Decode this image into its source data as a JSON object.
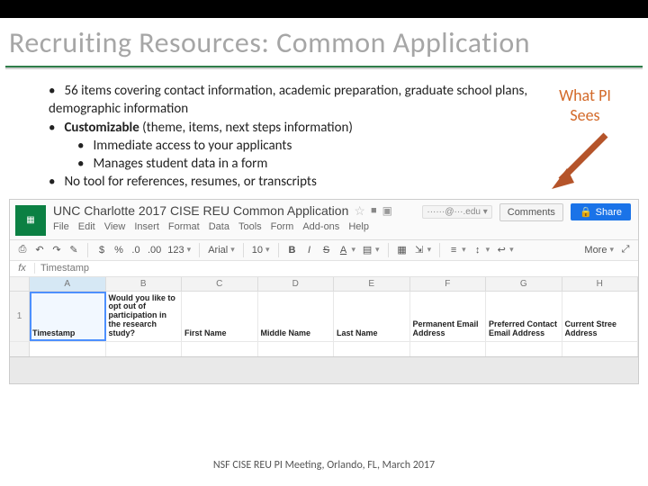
{
  "slide": {
    "title": "Recruiting Resources: Common Application",
    "bullets": {
      "b1": "56 items covering contact information, academic preparation, graduate school plans, demographic information",
      "b2_bold": "Customizable",
      "b2_rest": " (theme, items, next steps information)",
      "b2a": "Immediate access to your applicants",
      "b2b": "Manages student data in a form",
      "b3": "No tool for references, resumes, or transcripts"
    },
    "sideLabel1": "What PI",
    "sideLabel2": "Sees",
    "footer": "NSF CISE REU PI Meeting, Orlando, FL, March 2017"
  },
  "sheets": {
    "docTitle": "UNC Charlotte 2017 CISE REU Common Application",
    "location": "■",
    "menus": [
      "File",
      "Edit",
      "View",
      "Insert",
      "Format",
      "Data",
      "Tools",
      "Form",
      "Add-ons",
      "Help"
    ],
    "emailChip": "······@···.edu ▾",
    "comments": "Comments",
    "share": "Share",
    "toolbar": {
      "currency": "$",
      "percent": "%",
      "dec1": ".0",
      "dec2": ".00",
      "num": "123",
      "font": "Arial",
      "size": "10",
      "bold": "B",
      "italic": "I",
      "strike": "S",
      "underline": "A",
      "more": "More"
    },
    "fx": {
      "label": "fx",
      "value": "Timestamp"
    },
    "cols": [
      "A",
      "B",
      "C",
      "D",
      "E",
      "F",
      "G",
      "H"
    ],
    "headers": {
      "A": "Timestamp",
      "B": "Would you like to opt out of participation in the research study?",
      "C": "First Name",
      "D": "Middle Name",
      "E": "Last Name",
      "F": "Permanent Email Address",
      "G": "Preferred Contact Email Address",
      "H": "Current Stree Address"
    }
  }
}
